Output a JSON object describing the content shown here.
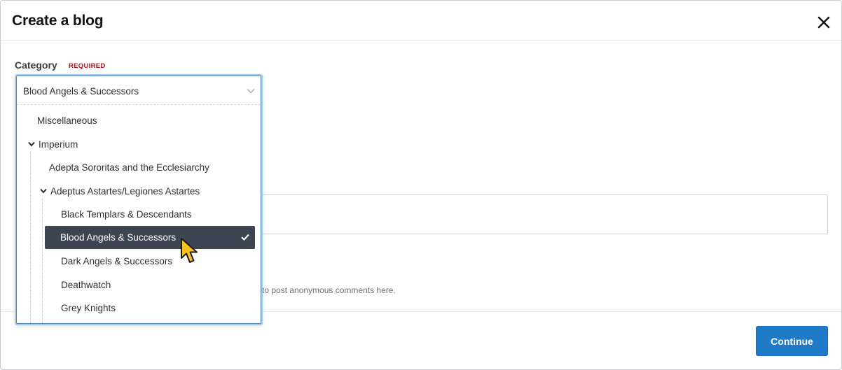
{
  "modal": {
    "title": "Create a blog",
    "close_icon": "close-icon"
  },
  "category": {
    "label": "Category",
    "required": "REQUIRED",
    "selected_value": "Blood Angels & Successors",
    "chevron_icon": "chevron-down-icon"
  },
  "options": [
    {
      "label": "Miscellaneous"
    },
    {
      "label": "Imperium",
      "expanded": true
    },
    {
      "label": "Adepta Sororitas and the Ecclesiarchy"
    },
    {
      "label": "Adeptus Astartes/Legiones Astartes",
      "expanded": true
    },
    {
      "label": "Black Templars & Descendants"
    },
    {
      "label": "Blood Angels & Successors",
      "selected": true
    },
    {
      "label": "Dark Angels & Successors"
    },
    {
      "label": "Deathwatch"
    },
    {
      "label": "Grey Knights"
    }
  ],
  "background": {
    "hint_fragment": "to post anonymous comments here."
  },
  "footer": {
    "continue_label": "Continue"
  },
  "colors": {
    "primary": "#1f7ac7",
    "selected_bg": "#3d4552",
    "required": "#b1181e"
  }
}
